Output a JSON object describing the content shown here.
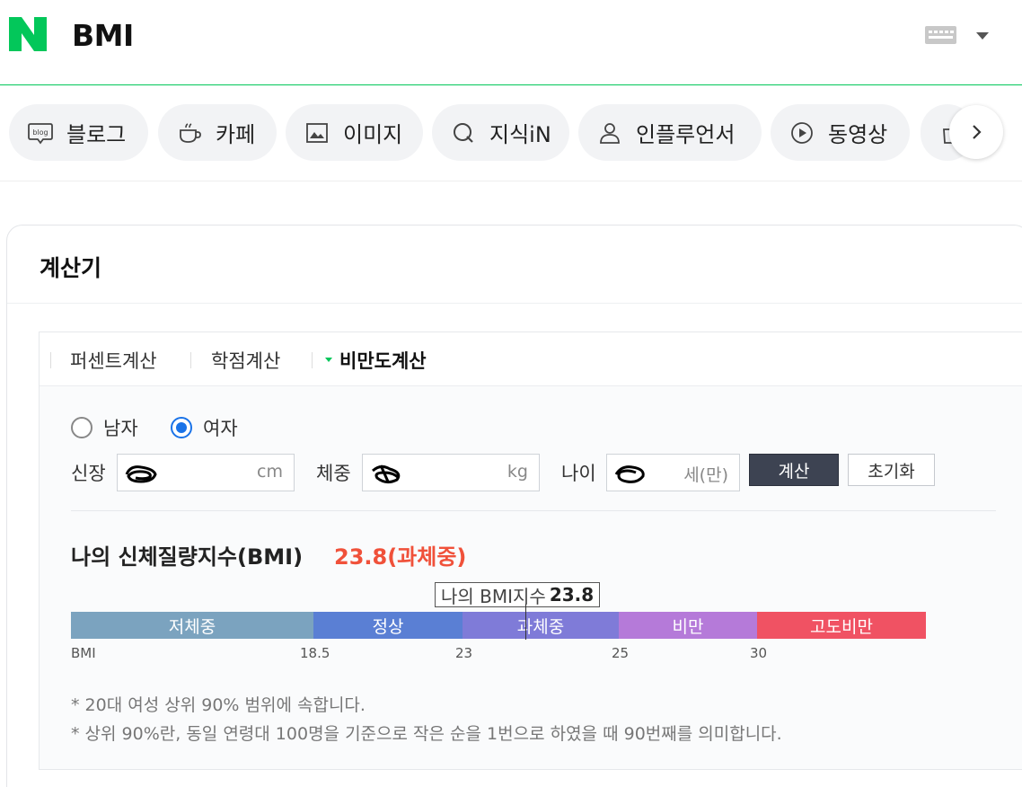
{
  "header": {
    "query": "BMI"
  },
  "tabs": [
    {
      "label": "블로그",
      "icon": "blog-icon"
    },
    {
      "label": "카페",
      "icon": "cafe-cup-icon"
    },
    {
      "label": "이미지",
      "icon": "image-icon"
    },
    {
      "label": "지식iN",
      "icon": "kin-q-icon"
    },
    {
      "label": "인플루언서",
      "icon": "person-icon"
    },
    {
      "label": "동영상",
      "icon": "play-icon"
    }
  ],
  "card": {
    "title": "계산기"
  },
  "calc": {
    "tabs": [
      "퍼센트계산",
      "학점계산",
      "비만도계산"
    ],
    "active_tab": "비만도계산",
    "gender": {
      "male_label": "남자",
      "female_label": "여자",
      "selected": "여자"
    },
    "fields": {
      "height_label": "신장",
      "height_unit": "cm",
      "weight_label": "체중",
      "weight_unit": "kg",
      "age_label": "나이",
      "age_unit": "세(만)"
    },
    "buttons": {
      "calculate": "계산",
      "reset": "초기화"
    }
  },
  "result": {
    "title": "나의 신체질량지수(BMI)",
    "value": "23.8(과체중)",
    "marker_label": "나의 BMI지수",
    "marker_value": "23.8",
    "bmi": 23.8,
    "categories": [
      {
        "label": "저체중",
        "color": "#7ba3bf"
      },
      {
        "label": "정상",
        "color": "#5a7fd4"
      },
      {
        "label": "과체중",
        "color": "#7f7bd8"
      },
      {
        "label": "비만",
        "color": "#b57ad9"
      },
      {
        "label": "고도비만",
        "color": "#f05263"
      }
    ],
    "ticks": [
      "BMI",
      "18.5",
      "23",
      "25",
      "30"
    ],
    "notes": [
      "* 20대 여성 상위 90% 범위에 속합니다.",
      "* 상위 90%란, 동일 연령대 100명을 기준으로 작은 순을 1번으로 하였을 때 90번째를 의미합니다."
    ]
  },
  "colors": {
    "brand_green": "#03c75a",
    "result_red": "#f0513a",
    "radio_blue": "#1a73e8"
  }
}
